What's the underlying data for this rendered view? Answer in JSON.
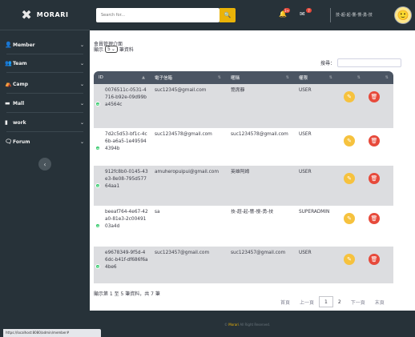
{
  "brand": {
    "name": "MORARI",
    "logo_icon": "crossed-tools-icon"
  },
  "sidebar": {
    "items": [
      {
        "label": "Member",
        "icon": "user-icon"
      },
      {
        "label": "Team",
        "icon": "team-icon"
      },
      {
        "label": "Camp",
        "icon": "camp-icon"
      },
      {
        "label": "Mall",
        "icon": "store-icon"
      },
      {
        "label": "work",
        "icon": "file-icon"
      },
      {
        "label": "Forum",
        "icon": "forum-icon"
      }
    ],
    "chevron": "⌄",
    "toggle_glyph": "‹"
  },
  "topbar": {
    "search_placeholder": "Search for...",
    "alerts_badge": "3+",
    "messages_badge": "7",
    "user_name": "技-超-起-響-慢-勇-技"
  },
  "main": {
    "title": "會員管理介面",
    "length_prefix": "顯示",
    "length_value": "5",
    "length_suffix": "筆資料",
    "filter_label": "搜尋："
  },
  "table": {
    "columns": [
      "ID",
      "電子信箱",
      "暱稱",
      "權限",
      "",
      ""
    ],
    "rows": [
      {
        "id": "0076511c-0531-4716-b92e-09d99ba4564c",
        "email": "suc12345@gmail.com",
        "nickname": "箆席靜",
        "role": "USER"
      },
      {
        "id": "7d2c5d53-bf1c-4c6b-a6a5-1e495944394b",
        "email": "suc1234578@gmail.com",
        "nickname": "suc1234578@gmail.com",
        "role": "USER"
      },
      {
        "id": "912fc8b0-0145-43e3-8e08-795d57764aa1",
        "email": "amuheropuipui@gmail.com",
        "nickname": "英雄阿姆",
        "role": "USER"
      },
      {
        "id": "beeaf764-4e67-42a0-81e3-2c0049103a4d",
        "email": "sa",
        "nickname": "技-超-起-響-慢-勇-技",
        "role": "SUPERADMIN"
      },
      {
        "id": "e9678349-9f5d-46dc-b41f-df686f6a4be6",
        "email": "suc123457@gmail.com",
        "nickname": "suc123457@gmail.com",
        "role": "USER"
      }
    ]
  },
  "table_info": "顯示第 1 至 5 筆資料，共 7 筆",
  "pagination": {
    "first": "首頁",
    "prev": "上一頁",
    "pages": [
      "1",
      "2"
    ],
    "current": "1",
    "next": "下一頁",
    "last": "末頁"
  },
  "footer": {
    "brand": "Morari",
    "text": "All Right Reserved."
  },
  "status_url": "https://localhost:8080/admin/member#"
}
